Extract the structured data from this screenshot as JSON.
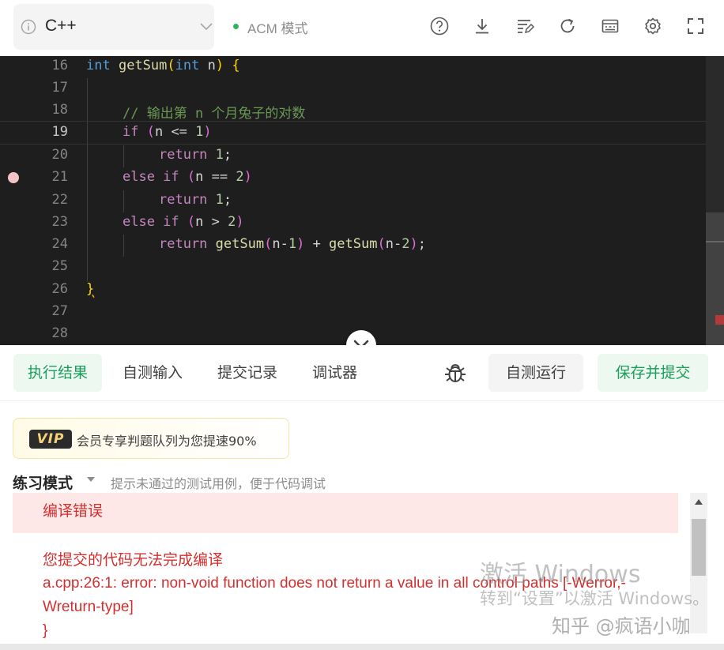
{
  "toolbar": {
    "language": "C++",
    "mode": "ACM 模式",
    "icons": [
      "help-icon",
      "download-icon",
      "format-icon",
      "reset-icon",
      "shortcut-icon",
      "settings-icon",
      "fullscreen-icon"
    ]
  },
  "editor": {
    "lines": [
      {
        "n": "16"
      },
      {
        "n": "17"
      },
      {
        "n": "18"
      },
      {
        "n": "19"
      },
      {
        "n": "20"
      },
      {
        "n": "21"
      },
      {
        "n": "22"
      },
      {
        "n": "23"
      },
      {
        "n": "24"
      },
      {
        "n": "25"
      },
      {
        "n": "26"
      },
      {
        "n": "27"
      },
      {
        "n": "28"
      }
    ],
    "code": {
      "l16": {
        "kw1": "int",
        "fn": "getSum",
        "p1": "(",
        "kw2": "int",
        "arg": " n",
        "p2": ")",
        "rest": " {"
      },
      "l18": "// 输出第 n 个月兔子的对数",
      "l19": {
        "kw": "if",
        "a": " (n <= ",
        "num": "1",
        "b": ")"
      },
      "l20": {
        "kw": "return",
        "num": " 1",
        ";": ";"
      },
      "l21": {
        "kw": "else if",
        "a": " (n == ",
        "num": "2",
        "b": ")"
      },
      "l22": {
        "kw": "return",
        "num": " 1",
        ";": ";"
      },
      "l23": {
        "kw": "else if",
        "a": " (n > ",
        "num": "2",
        "b": ")"
      },
      "l24": {
        "kw": "return",
        "fn1": "getSum",
        "a": "(n-",
        "n1": "1",
        "b": ") + ",
        "fn2": "getSum",
        "c": "(n-",
        "n2": "2",
        "d": ");"
      },
      "l26": "}"
    }
  },
  "tabs": {
    "result": "执行结果",
    "custom_input": "自测输入",
    "submissions": "提交记录",
    "debugger": "调试器",
    "run": "自测运行",
    "submit": "保存并提交"
  },
  "vip": {
    "badge": "VIP",
    "text": "会员专享判题队列为您提速90%"
  },
  "practice": {
    "title": "练习模式",
    "hint": "提示未通过的测试用例，便于代码调试"
  },
  "result": {
    "status": "编译错误",
    "message_title": "您提交的代码无法完成编译",
    "message_body": "a.cpp:26:1: error: non-void function does not return a value in all control paths [-Werror,-Wreturn-type]",
    "message_tail": "}"
  },
  "watermark": {
    "line1": "激活 Windows",
    "line2": "转到“设置”以激活 Windows。",
    "brand": "知乎 @疯语小咖"
  },
  "colors": {
    "accent": "#1b9e5a",
    "error": "#d32f2f",
    "editor_bg": "#1e1e1e"
  }
}
